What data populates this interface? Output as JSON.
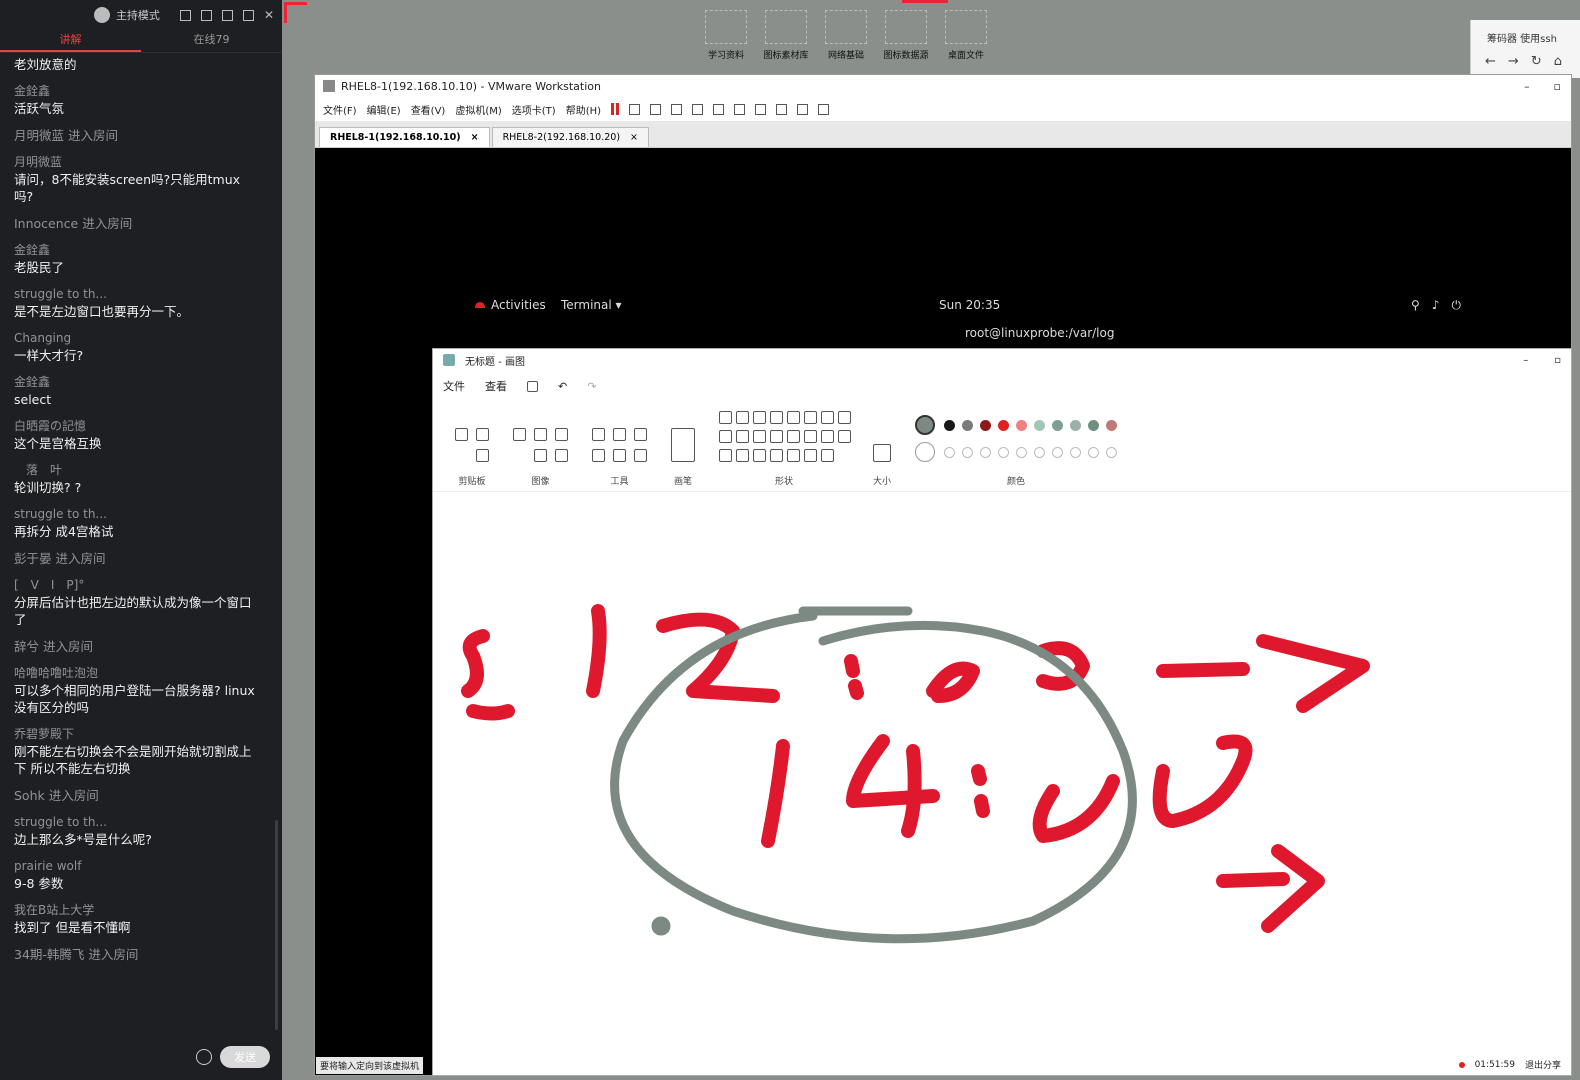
{
  "chat": {
    "header": {
      "mode_label": "主持模式"
    },
    "tabs": [
      "讲解",
      "在线79"
    ],
    "messages": [
      {
        "type": "partial",
        "text": "老刘放意的"
      },
      {
        "type": "msg",
        "name": "金銓鑫",
        "text": "活跃气氛"
      },
      {
        "type": "enter",
        "text": "月明微蓝 进入房间"
      },
      {
        "type": "msg",
        "name": "月明微蓝",
        "text": "请问，8不能安装screen吗?只能用tmux吗?"
      },
      {
        "type": "enter",
        "text": "Innocence 进入房间"
      },
      {
        "type": "msg",
        "name": "金銓鑫",
        "text": "老股民了"
      },
      {
        "type": "msg",
        "name": "struggle to th...",
        "text": "是不是左边窗口也要再分一下。"
      },
      {
        "type": "msg",
        "name": "Changing",
        "text": "一样大才行?"
      },
      {
        "type": "msg",
        "name": "金銓鑫",
        "text": "select"
      },
      {
        "type": "msg",
        "name": "白晒霞の記憶",
        "text": "这个是宫格互换"
      },
      {
        "type": "msg",
        "name": "　落　叶",
        "text": "轮训切换? ?"
      },
      {
        "type": "msg",
        "name": "struggle to th...",
        "text": "再拆分 成4宫格试"
      },
      {
        "type": "enter",
        "text": "彭于晏 进入房间"
      },
      {
        "type": "msg",
        "name": "[　V　I　P]°",
        "text": "分屏后估计也把左边的默认成为像一个窗口了"
      },
      {
        "type": "enter",
        "text": "辞兮 进入房间"
      },
      {
        "type": "msg",
        "name": "哈噜哈噜吐泡泡",
        "text": "可以多个相同的用户登陆一台服务器? linux没有区分的吗"
      },
      {
        "type": "msg",
        "name": "乔碧萝殿下",
        "text": "刚不能左右切换会不会是刚开始就切割成上下 所以不能左右切换"
      },
      {
        "type": "enter",
        "text": "Sohk 进入房间"
      },
      {
        "type": "msg",
        "name": "struggle to th...",
        "text": "边上那么多*号是什么呢?"
      },
      {
        "type": "msg",
        "name": "prairie wolf",
        "text": "9-8 参数"
      },
      {
        "type": "msg",
        "name": "我在B站上大学",
        "text": "找到了 但是看不懂啊"
      },
      {
        "type": "enter",
        "text": "34期-韩腾飞 进入房间"
      }
    ],
    "send_label": "发送"
  },
  "desktop": {
    "icons": [
      "学习资料",
      "图标素材库",
      "网络基础",
      "图标数据源",
      "桌面文件"
    ],
    "browser_tab": "筹码器 使用ssh"
  },
  "vmware": {
    "title": "RHEL8-1(192.168.10.10) - VMware Workstation",
    "menu": [
      "文件(F)",
      "编辑(E)",
      "查看(V)",
      "虚拟机(M)",
      "选项卡(T)",
      "帮助(H)"
    ],
    "tabs": [
      "RHEL8-1(192.168.10.10)",
      "RHEL8-2(192.168.10.20)"
    ],
    "gnome": {
      "activities": "Activities",
      "app": "Terminal ▾",
      "clock": "Sun 20:35"
    },
    "terminal_title": "root@linuxprobe:/var/log",
    "hint": "要将输入定向到该虚拟机"
  },
  "paint": {
    "title": "无标题 - 画图",
    "menu": [
      "文件",
      "查看"
    ],
    "groups": [
      "剪贴板",
      "图像",
      "工具",
      "画笔",
      "形状",
      "大小",
      "颜色"
    ],
    "colors_row1": [
      "#1a1a1a",
      "#7a7a7a",
      "#8b1a1a",
      "#e02020",
      "#f08080",
      "#a0c8b8",
      "#7f9f8f",
      "#9bb0a8",
      "#6f8f7f",
      "#c07878"
    ],
    "annotation_color": "#e0182d",
    "circle_color": "#7d8a84"
  },
  "status": {
    "time": "01:51:59",
    "stop_share": "退出分享"
  }
}
